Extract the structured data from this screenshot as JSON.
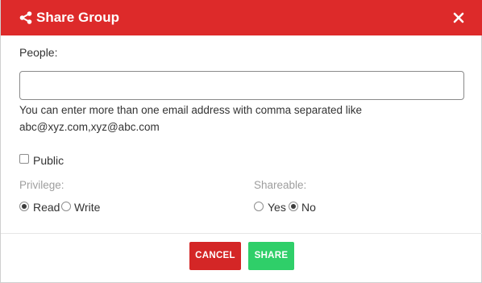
{
  "header": {
    "title": "Share Group",
    "icon": "share-icon",
    "close_icon": "close-icon",
    "background": "#dd2a2a"
  },
  "form": {
    "people_label": "People:",
    "people_value": "",
    "people_placeholder": "",
    "help_line1": "You can enter more than one email address with comma separated like",
    "help_line2": "abc@xyz.com,xyz@abc.com",
    "public_label": "Public",
    "public_checked": false,
    "privilege": {
      "label": "Privilege:",
      "options": [
        "Read",
        "Write"
      ],
      "selected": "Read"
    },
    "shareable": {
      "label": "Shareable:",
      "options": [
        "Yes",
        "No"
      ],
      "selected": "No"
    }
  },
  "footer": {
    "cancel_label": "CANCEL",
    "share_label": "SHARE",
    "cancel_color": "#d42626",
    "share_color": "#2fcf69"
  }
}
